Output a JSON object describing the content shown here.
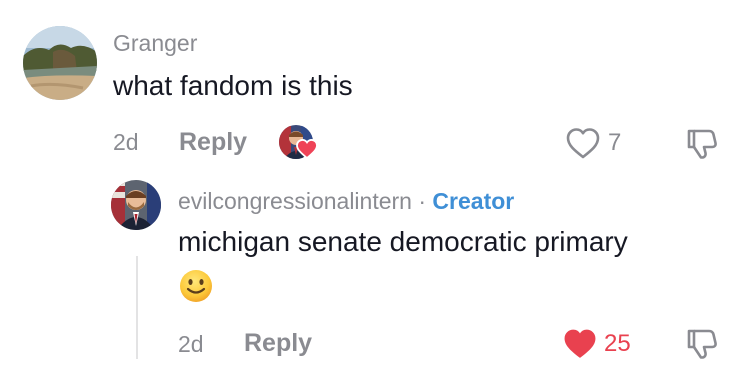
{
  "colors": {
    "secondary_text": "#8a8b91",
    "primary_text": "#161823",
    "creator_blue": "#3f8fd6",
    "like_red": "#e9414f",
    "thread_line": "#e3e3e4"
  },
  "comment": {
    "username": "Granger",
    "text": "what fandom is this",
    "date": "2d",
    "reply_label": "Reply",
    "like_count": "7",
    "liked_by_creator": true,
    "icons": {
      "avatar": "landscape-avatar",
      "creator_liked": "creator-liked-heart-icon",
      "like": "heart-outline-icon",
      "dislike": "thumbs-down-icon"
    }
  },
  "reply": {
    "username": "evilcongressionalintern",
    "separator": "·",
    "badge": "Creator",
    "text": "michigan senate democratic primary",
    "emoji": "slightly-smiling-face",
    "date": "2d",
    "reply_label": "Reply",
    "like_count": "25",
    "liked": true,
    "icons": {
      "avatar": "person-portrait-avatar",
      "like": "heart-filled-icon",
      "dislike": "thumbs-down-icon"
    }
  }
}
